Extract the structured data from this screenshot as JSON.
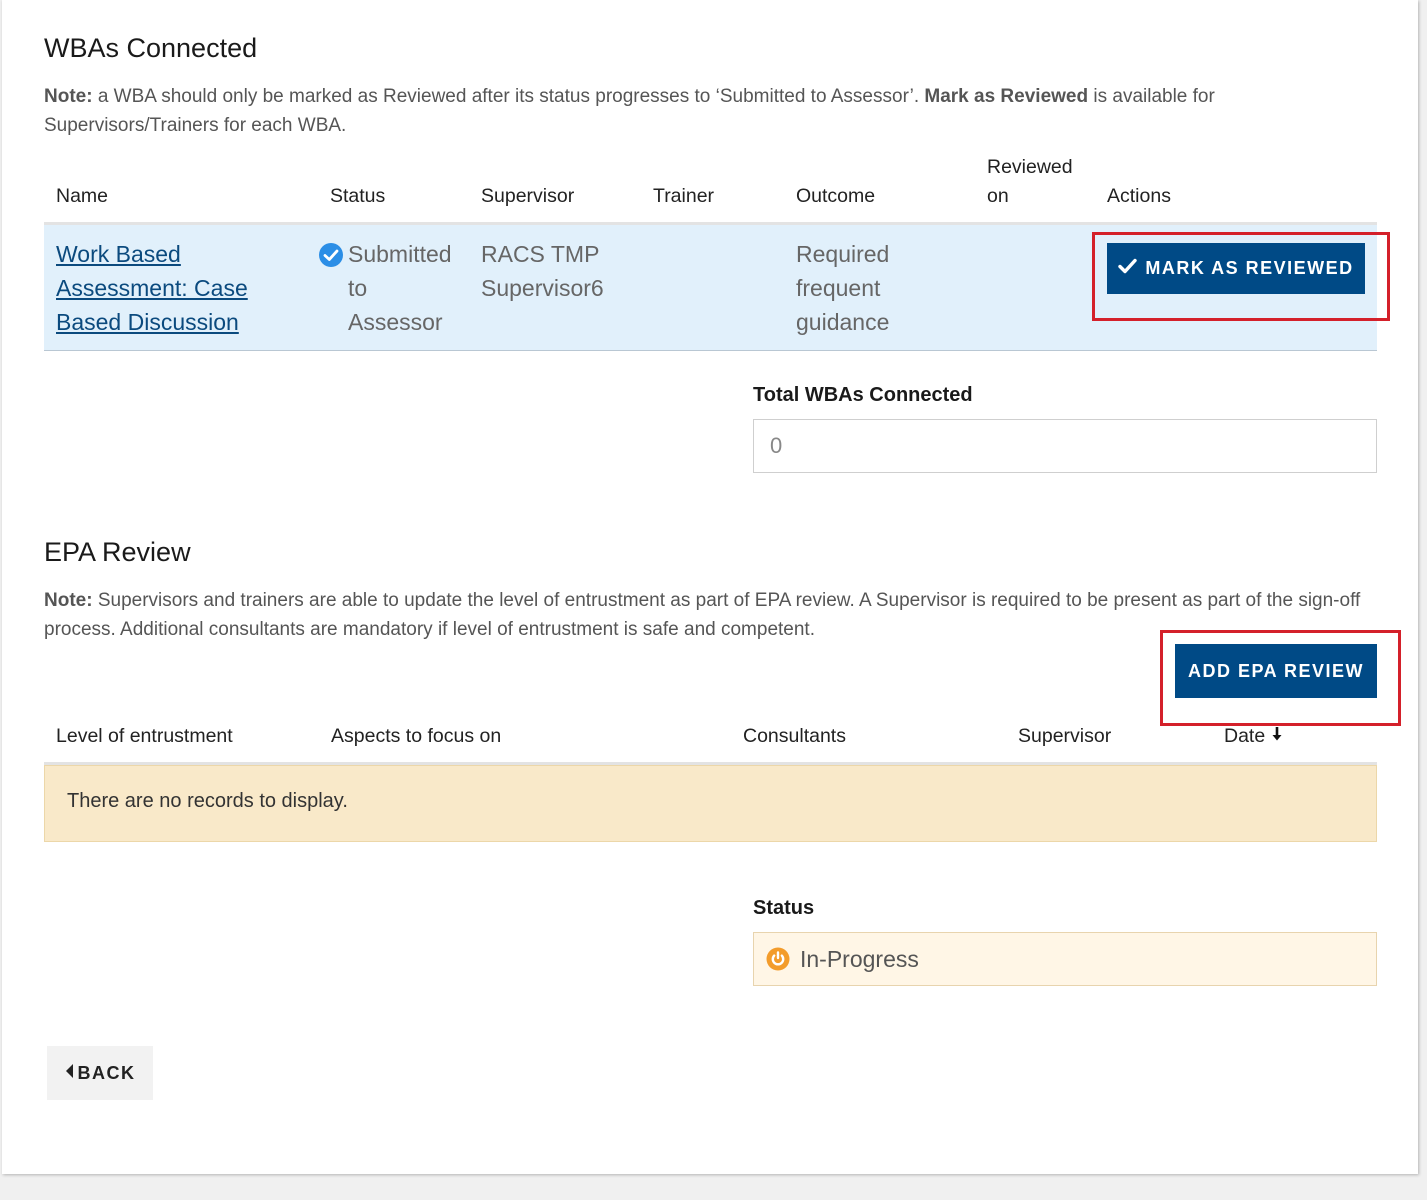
{
  "wba": {
    "title": "WBAs Connected",
    "note_prefix": "Note:",
    "note_text_1": " a WBA should only be marked as Reviewed after its status progresses to ‘Submitted to Assessor’. ",
    "note_bold": "Mark as Reviewed",
    "note_text_2": " is available for Supervisors/Trainers for each WBA.",
    "columns": {
      "name": "Name",
      "status": "Status",
      "supervisor": "Supervisor",
      "trainer": "Trainer",
      "outcome": "Outcome",
      "reviewed_on": "Reviewed on",
      "actions": "Actions"
    },
    "row": {
      "name_line1": "Work Based",
      "name_line2": "Assessment: Case",
      "name_line3": "Based Discussion",
      "status_line1": "Submitted",
      "status_line2": "to",
      "status_line3": "Assessor",
      "status_icon": "check-circle-icon",
      "supervisor_line1": "RACS TMP",
      "supervisor_line2": "Supervisor6",
      "outcome_line1": "Required",
      "outcome_line2": "frequent",
      "outcome_line3": "guidance",
      "action_label": "MARK AS REVIEWED",
      "action_icon": "check-icon"
    },
    "total_label": "Total WBAs Connected",
    "total_value": "0"
  },
  "epa": {
    "title": "EPA Review",
    "note_prefix": "Note:",
    "note_text": " Supervisors and trainers are able to update the level of entrustment as part of EPA review. A Supervisor is required to be present as part of the sign-off process. Additional consultants are mandatory if level of entrustment is safe and competent.",
    "add_button": "ADD EPA REVIEW",
    "columns": {
      "level": "Level of entrustment",
      "aspects": "Aspects to focus on",
      "consultants": "Consultants",
      "supervisor": "Supervisor",
      "date": "Date"
    },
    "empty_message": "There are no records to display.",
    "status_label": "Status",
    "status_value": "In-Progress",
    "status_icon": "in-progress-icon"
  },
  "back_button": "BACK",
  "colors": {
    "primary": "#004a86",
    "highlight_red": "#d4202a",
    "row_highlight": "#e1f0fb",
    "empty_bg": "#f9e9c9",
    "status_bg": "#fff6e6",
    "status_orange": "#f39c2b",
    "check_blue": "#2b8ee6"
  }
}
